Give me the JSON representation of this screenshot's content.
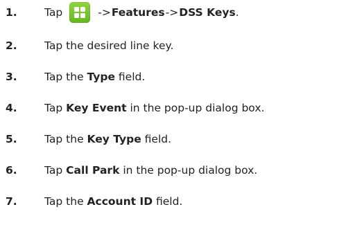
{
  "steps": [
    {
      "num": "1.",
      "pre": "Tap",
      "icon": "menu-grid-icon",
      "arrow1": "->",
      "b1": "Features",
      "arrow2": "->",
      "b2": "DSS Keys",
      "post": "."
    },
    {
      "num": "2.",
      "pre": "Tap the desired line key."
    },
    {
      "num": "3.",
      "pre": "Tap the ",
      "bold": "Type",
      "post": " field."
    },
    {
      "num": "4.",
      "pre": "Tap ",
      "bold": "Key Event",
      "post": " in the pop-up dialog box."
    },
    {
      "num": "5.",
      "pre": "Tap the ",
      "bold": "Key Type",
      "post": " field."
    },
    {
      "num": "6.",
      "pre": "Tap ",
      "bold": "Call Park",
      "post": " in the pop-up dialog box."
    },
    {
      "num": "7.",
      "pre": "Tap the ",
      "bold": "Account ID",
      "post": " field."
    }
  ],
  "colors": {
    "icon_green": "#74c62a",
    "text": "#222222"
  }
}
